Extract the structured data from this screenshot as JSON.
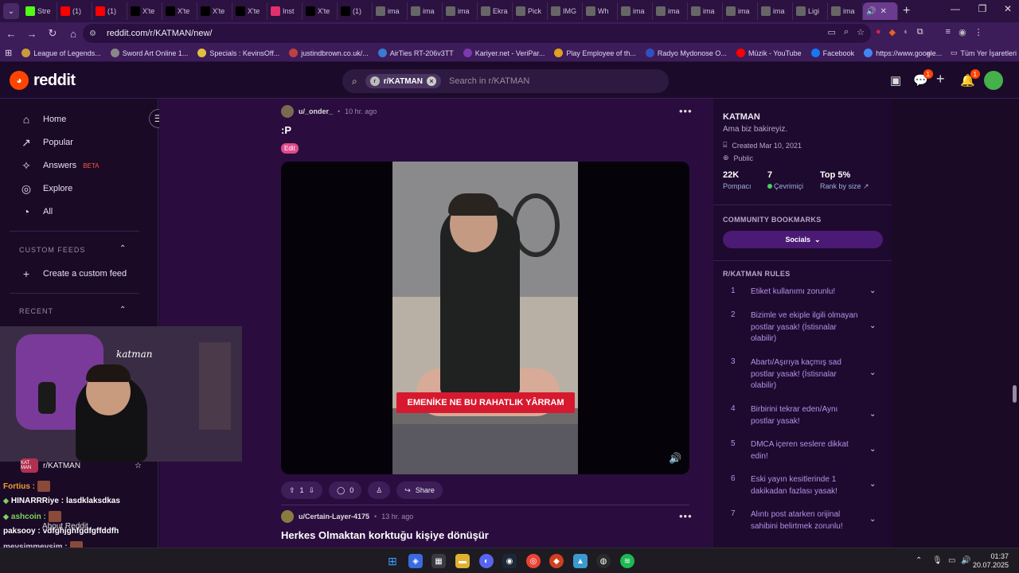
{
  "browser": {
    "tabs": [
      {
        "label": "Stre",
        "icon": "kick-icon",
        "color": "#53fc18"
      },
      {
        "label": "(1)",
        "icon": "youtube-icon",
        "color": "#ff0000"
      },
      {
        "label": "(1)",
        "icon": "youtube-icon",
        "color": "#ff0000"
      },
      {
        "label": "X'te",
        "icon": "x-icon",
        "color": "#000000"
      },
      {
        "label": "X'te",
        "icon": "x-icon",
        "color": "#000000"
      },
      {
        "label": "X'te",
        "icon": "x-icon",
        "color": "#000000"
      },
      {
        "label": "X'te",
        "icon": "x-icon",
        "color": "#000000"
      },
      {
        "label": "Inst",
        "icon": "instagram-icon",
        "color": "#e1306c"
      },
      {
        "label": "X'te",
        "icon": "x-icon",
        "color": "#000000"
      },
      {
        "label": "(1)",
        "icon": "x-icon",
        "color": "#000000"
      },
      {
        "label": "ima",
        "icon": "globe-icon",
        "color": "#666666"
      },
      {
        "label": "ima",
        "icon": "globe-icon",
        "color": "#666666"
      },
      {
        "label": "ima",
        "icon": "globe-icon",
        "color": "#666666"
      },
      {
        "label": "Ekra",
        "icon": "globe-icon",
        "color": "#666666"
      },
      {
        "label": "Pick",
        "icon": "globe-icon",
        "color": "#666666"
      },
      {
        "label": "IMG",
        "icon": "globe-icon",
        "color": "#666666"
      },
      {
        "label": "Wh",
        "icon": "globe-icon",
        "color": "#666666"
      },
      {
        "label": "ima",
        "icon": "globe-icon",
        "color": "#666666"
      },
      {
        "label": "ima",
        "icon": "globe-icon",
        "color": "#666666"
      },
      {
        "label": "ima",
        "icon": "globe-icon",
        "color": "#666666"
      },
      {
        "label": "ima",
        "icon": "globe-icon",
        "color": "#666666"
      },
      {
        "label": "ima",
        "icon": "globe-icon",
        "color": "#666666"
      },
      {
        "label": "Ligi",
        "icon": "pen-icon",
        "color": "#666666"
      },
      {
        "label": "ima",
        "icon": "globe-icon",
        "color": "#666666"
      }
    ],
    "active_tab_icon": "speaker-icon",
    "new_tab": "+",
    "url": "reddit.com/r/KATMAN/new/",
    "bookmarks": [
      {
        "label": "League of Legends...",
        "color": "#c89b3c"
      },
      {
        "label": "Sword Art Online 1...",
        "color": "#888888"
      },
      {
        "label": "Specials : KevinsOff...",
        "color": "#e0c040"
      },
      {
        "label": "justindbrown.co.uk/...",
        "color": "#c04040"
      },
      {
        "label": "AirTies RT-206v3TT",
        "color": "#3a7ad0"
      },
      {
        "label": "Kariyer.net - VeriPar...",
        "color": "#7a3ab0"
      },
      {
        "label": "Play Employee of th...",
        "color": "#e0a020"
      },
      {
        "label": "Radyo Mydonose O...",
        "color": "#3050c0"
      },
      {
        "label": "Müzik - YouTube",
        "color": "#ff0000"
      },
      {
        "label": "Facebook",
        "color": "#1877f2"
      },
      {
        "label": "https://www.google...",
        "color": "#4285f4"
      }
    ],
    "bookmarks_more": "»",
    "all_bookmarks": "Tüm Yer İşaretleri"
  },
  "reddit": {
    "logo_text": "reddit",
    "search_chip": "r/KATMAN",
    "search_placeholder": "Search in r/KATMAN",
    "chat_badge": "1",
    "notif_badge": "1",
    "colors": {
      "accent": "#ff4500",
      "online": "#46d160"
    }
  },
  "leftnav": {
    "items": [
      {
        "label": "Home",
        "icon": "home-icon"
      },
      {
        "label": "Popular",
        "icon": "popular-icon"
      },
      {
        "label": "Answers",
        "icon": "answers-icon",
        "badge": "BETA"
      },
      {
        "label": "Explore",
        "icon": "explore-icon"
      },
      {
        "label": "All",
        "icon": "all-icon"
      }
    ],
    "custom_feeds_heading": "CUSTOM FEEDS",
    "create_feed": "Create a custom feed",
    "recent_heading": "RECENT",
    "recent_sub": "r/KATMAN",
    "recent_sub_icon_text": "KAT MAN",
    "about": "About Reddit"
  },
  "posts": [
    {
      "author": "u/_onder_",
      "time": "10 hr. ago",
      "title": ":P",
      "flair": "Edit",
      "video_caption": "EMENİKE NE BU RAHATLIK YÂRRAM",
      "votes": "1",
      "comments": "0",
      "share": "Share"
    },
    {
      "author": "u/Certain-Layer-4175",
      "time": "13 hr. ago",
      "title": "Herkes Olmaktan korktuğu kişiye dönüşür"
    }
  ],
  "community": {
    "name": "KATMAN",
    "tagline": "Ama biz bakireyiz.",
    "created": "Created Mar 10, 2021",
    "visibility": "Public",
    "members_value": "22K",
    "members_label": "Pompacı",
    "online_value": "7",
    "online_label": "Çevrimiçi",
    "rank_value": "Top 5%",
    "rank_label": "Rank by size",
    "bookmarks_heading": "COMMUNITY BOOKMARKS",
    "socials": "Socials",
    "rules_heading": "R/KATMAN RULES",
    "rules": [
      "Etiket kullanımı zorunlu!",
      "Bizimle ve ekiple ilgili olmayan postlar yasak! (İstisnalar olabilir)",
      "Abartı/Aşırıya kaçmış sad postlar yasak! (İstisnalar olabilir)",
      "Birbirini tekrar eden/Aynı postlar yasak!",
      "DMCA içeren seslere dikkat edin!",
      "Eski yayın kesitlerinde 1 dakikadan fazlası yasak!",
      "Alıntı post atarken orijinal sahibini belirtmek zorunlu!"
    ]
  },
  "overlay": {
    "stream_logo": "katman"
  },
  "chat": [
    {
      "user": "Fortius :",
      "msg": "",
      "color": "#f0a030",
      "emote": true
    },
    {
      "user": "HINARRRiye :",
      "msg": "lasdklaksdkas",
      "color": "#ffffff",
      "gem": true
    },
    {
      "user": "ashcoin :",
      "msg": "",
      "color": "#7cd35c",
      "gem": true,
      "emote": true
    },
    {
      "user": "paksooy :",
      "msg": "vdfghjghfgdfgffddfh",
      "color": "#ffffff"
    },
    {
      "user": "mevsimmevsim :",
      "msg": "",
      "color": "#cfc0e0",
      "emote": true
    }
  ],
  "taskbar": {
    "time": "01:37",
    "date": "20.07.2025"
  }
}
